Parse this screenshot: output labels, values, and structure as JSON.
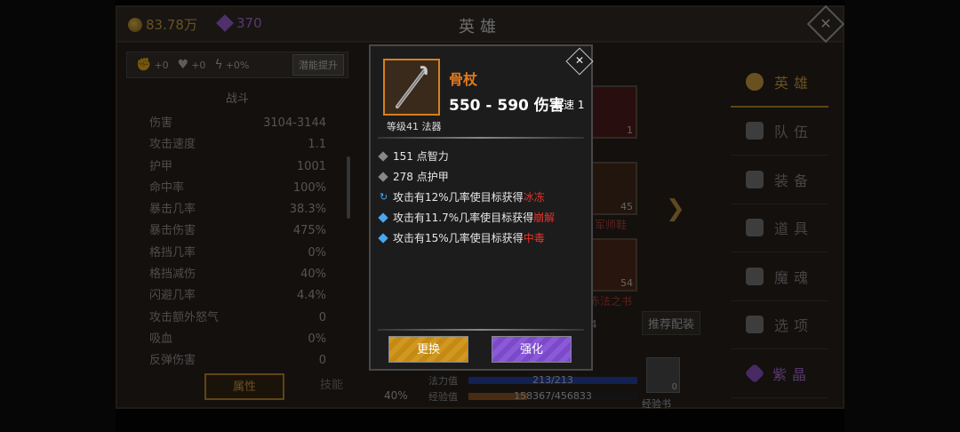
{
  "header": {
    "gold": "83.78万",
    "gems": "370",
    "title": "英雄"
  },
  "boosts": {
    "b1": "+0",
    "b2": "+0",
    "b3": "+0%",
    "latent_label": "潜能提升"
  },
  "stats": {
    "section_title": "战斗",
    "rows": [
      {
        "label": "伤害",
        "value": "3104-3144"
      },
      {
        "label": "攻击速度",
        "value": "1.1"
      },
      {
        "label": "护甲",
        "value": "1001"
      },
      {
        "label": "命中率",
        "value": "100%"
      },
      {
        "label": "暴击几率",
        "value": "38.3%"
      },
      {
        "label": "暴击伤害",
        "value": "475%"
      },
      {
        "label": "格挡几率",
        "value": "0%"
      },
      {
        "label": "格挡减伤",
        "value": "40%"
      },
      {
        "label": "闪避几率",
        "value": "4.4%"
      },
      {
        "label": "攻击额外怒气",
        "value": "0"
      },
      {
        "label": "吸血",
        "value": "0%"
      },
      {
        "label": "反弹伤害",
        "value": "0"
      }
    ],
    "tab_attr": "属性",
    "tab_skill": "技能"
  },
  "middle": {
    "slot1_count": "1",
    "slot2_count": "45",
    "slot2_label": "军师鞋",
    "slot3_count": "54",
    "slot3_label": "赤法之书",
    "recommend": "推荐配装",
    "partial_num": "4",
    "pct": "40%",
    "mana_label": "法力值",
    "mana_value": "213/213",
    "mana_fill": 1.0,
    "exp_label": "经验值",
    "exp_value": "158367/456833",
    "exp_fill": 0.347,
    "book_count": "0",
    "book_label": "经验书"
  },
  "nav": {
    "items": [
      "英雄",
      "队伍",
      "装备",
      "道具",
      "魔魂",
      "选项",
      "紫晶"
    ]
  },
  "popup": {
    "name": "骨杖",
    "damage": "550 - 590 伤害",
    "speed": "攻速 1",
    "level": "等级41 法器",
    "attr1": "151 点智力",
    "attr2": "278 点护甲",
    "attr3_prefix": "攻击有12%几率使目标获得",
    "attr3_effect": "冰冻",
    "attr4_prefix": "攻击有11.7%几率使目标获得",
    "attr4_effect": "崩解",
    "attr5_prefix": "攻击有15%几率使目标获得",
    "attr5_effect": "中毒",
    "btn_swap": "更换",
    "btn_enhance": "强化"
  },
  "colors": {
    "gold": "#e8b24a",
    "purple": "#c47df4",
    "item_orange": "#e07a1e",
    "effect_red": "#e8322a"
  }
}
